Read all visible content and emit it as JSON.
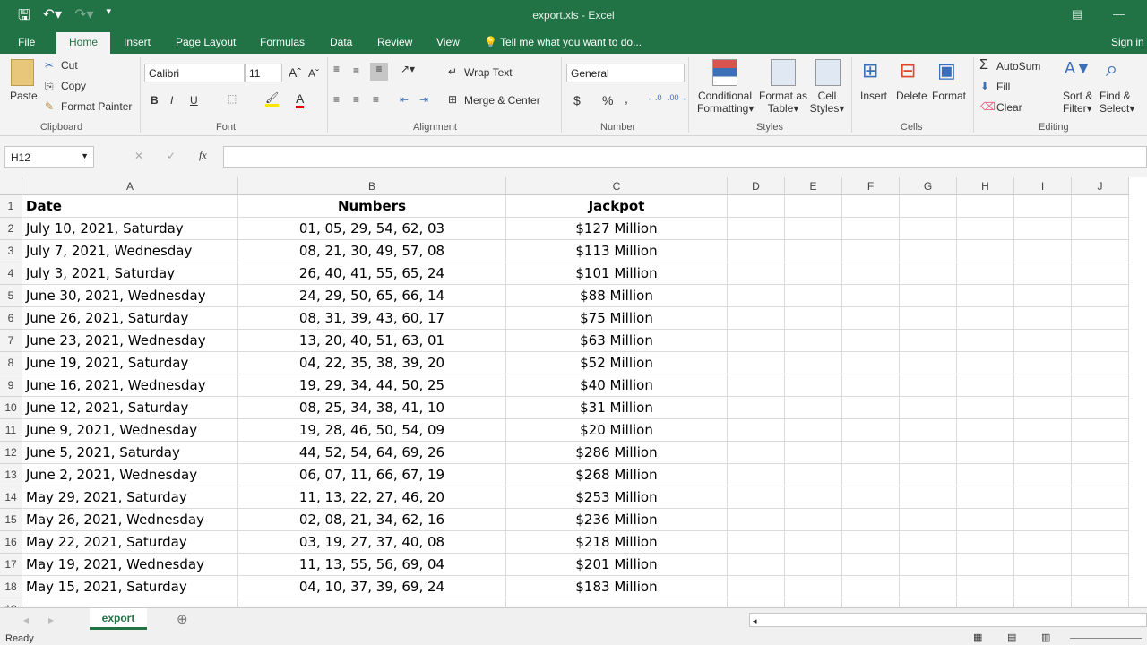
{
  "app": {
    "title": "export.xls - Excel"
  },
  "tabs": [
    {
      "label": "File"
    },
    {
      "label": "Home"
    },
    {
      "label": "Insert"
    },
    {
      "label": "Page Layout"
    },
    {
      "label": "Formulas"
    },
    {
      "label": "Data"
    },
    {
      "label": "Review"
    },
    {
      "label": "View"
    }
  ],
  "tell_me": "Tell me what you want to do...",
  "sign_in": "Sign in",
  "ribbon": {
    "paste": "Paste",
    "cut": "Cut",
    "copy": "Copy",
    "format_painter": "Format Painter",
    "clipboard": "Clipboard",
    "font_name": "Calibri",
    "font_size": "11",
    "bold": "B",
    "italic": "I",
    "underline": "U",
    "font": "Font",
    "wrap_text": "Wrap Text",
    "merge_center": "Merge & Center",
    "alignment": "Alignment",
    "number_format": "General",
    "currency": "$",
    "percent": "%",
    "comma": ",",
    "number": "Number",
    "conditional1": "Conditional",
    "conditional2": "Formatting",
    "format_as1": "Format as",
    "format_as2": "Table",
    "cell1": "Cell",
    "cell2": "Styles",
    "styles": "Styles",
    "insert": "Insert",
    "delete": "Delete",
    "format": "Format",
    "cells": "Cells",
    "autosum": "AutoSum",
    "fill": "Fill",
    "clear": "Clear",
    "sort1": "Sort &",
    "sort2": "Filter",
    "find1": "Find &",
    "find2": "Select",
    "editing": "Editing"
  },
  "formula_bar": {
    "name_box": "H12",
    "formula": "",
    "fx": "fx"
  },
  "columns": [
    "A",
    "B",
    "C",
    "D",
    "E",
    "F",
    "G",
    "H",
    "I",
    "J"
  ],
  "rows": [
    [
      "Date",
      "Numbers",
      "Jackpot"
    ],
    [
      "July 10, 2021, Saturday",
      "01, 05, 29, 54, 62, 03",
      "$127 Million"
    ],
    [
      "July 7, 2021, Wednesday",
      "08, 21, 30, 49, 57, 08",
      "$113 Million"
    ],
    [
      "July 3, 2021, Saturday",
      "26, 40, 41, 55, 65, 24",
      "$101 Million"
    ],
    [
      "June 30, 2021, Wednesday",
      "24, 29, 50, 65, 66, 14",
      "$88 Million"
    ],
    [
      "June 26, 2021, Saturday",
      "08, 31, 39, 43, 60, 17",
      "$75 Million"
    ],
    [
      "June 23, 2021, Wednesday",
      "13, 20, 40, 51, 63, 01",
      "$63 Million"
    ],
    [
      "June 19, 2021, Saturday",
      "04, 22, 35, 38, 39, 20",
      "$52 Million"
    ],
    [
      "June 16, 2021, Wednesday",
      "19, 29, 34, 44, 50, 25",
      "$40 Million"
    ],
    [
      "June 12, 2021, Saturday",
      "08, 25, 34, 38, 41, 10",
      "$31 Million"
    ],
    [
      "June 9, 2021, Wednesday",
      "19, 28, 46, 50, 54, 09",
      "$20 Million"
    ],
    [
      "June 5, 2021, Saturday",
      "44, 52, 54, 64, 69, 26",
      "$286 Million"
    ],
    [
      "June 2, 2021, Wednesday",
      "06, 07, 11, 66, 67, 19",
      "$268 Million"
    ],
    [
      "May 29, 2021, Saturday",
      "11, 13, 22, 27, 46, 20",
      "$253 Million"
    ],
    [
      "May 26, 2021, Wednesday",
      "02, 08, 21, 34, 62, 16",
      "$236 Million"
    ],
    [
      "May 22, 2021, Saturday",
      "03, 19, 27, 37, 40, 08",
      "$218 Million"
    ],
    [
      "May 19, 2021, Wednesday",
      "11, 13, 55, 56, 69, 04",
      "$201 Million"
    ],
    [
      "May 15, 2021, Saturday",
      "04, 10, 37, 39, 69, 24",
      "$183 Million"
    ]
  ],
  "sheets": [
    {
      "label": "export"
    }
  ],
  "status": "Ready",
  "colors": {
    "brand": "#217346"
  }
}
